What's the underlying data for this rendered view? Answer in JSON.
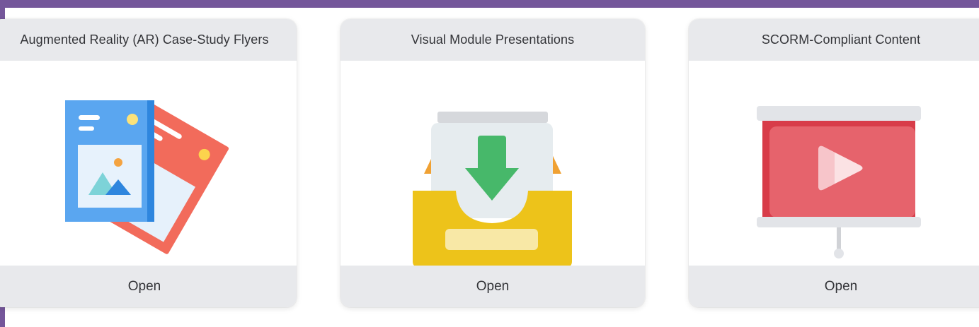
{
  "colors": {
    "frame": "#74569a",
    "card_header_bg": "#e8e9ec"
  },
  "cards": [
    {
      "title": "Augmented Reality (AR) Case-Study Flyers",
      "icon": "flyers-icon",
      "action_label": "Open"
    },
    {
      "title": "Visual Module Presentations",
      "icon": "inbox-download-icon",
      "action_label": "Open"
    },
    {
      "title": "SCORM-Compliant Content",
      "icon": "video-projector-screen-icon",
      "action_label": "Open"
    }
  ]
}
